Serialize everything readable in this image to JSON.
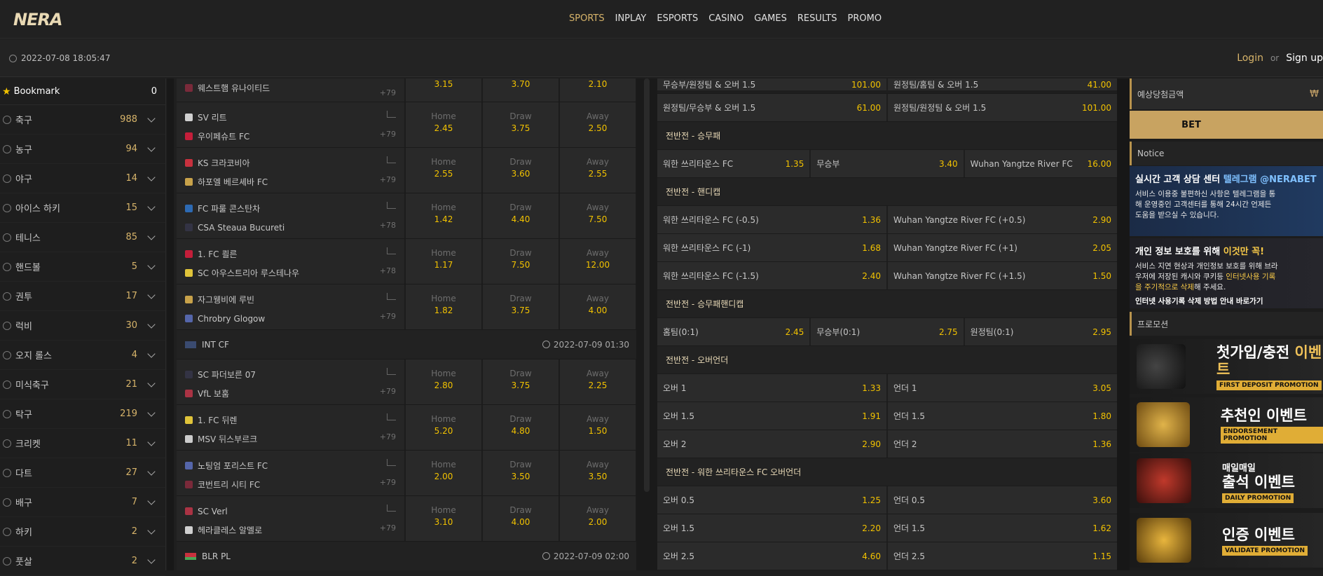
{
  "logo": "NERA",
  "nav": [
    "SPORTS",
    "INPLAY",
    "ESPORTS",
    "CASINO",
    "GAMES",
    "RESULTS",
    "PROMO"
  ],
  "datetime": "2022-07-08 18:05:47",
  "auth": {
    "login": "Login",
    "or": "or",
    "signup": "Sign up"
  },
  "sidebar": {
    "bookmark": {
      "label": "Bookmark",
      "count": "0"
    },
    "items": [
      {
        "label": "축구",
        "count": "988"
      },
      {
        "label": "농구",
        "count": "94"
      },
      {
        "label": "야구",
        "count": "14"
      },
      {
        "label": "아이스 하키",
        "count": "15"
      },
      {
        "label": "테니스",
        "count": "85"
      },
      {
        "label": "핸드볼",
        "count": "5"
      },
      {
        "label": "권투",
        "count": "17"
      },
      {
        "label": "럭비",
        "count": "30"
      },
      {
        "label": "오지 롤스",
        "count": "4"
      },
      {
        "label": "미식축구",
        "count": "21"
      },
      {
        "label": "탁구",
        "count": "219"
      },
      {
        "label": "크리켓",
        "count": "11"
      },
      {
        "label": "다트",
        "count": "27"
      },
      {
        "label": "배구",
        "count": "7"
      },
      {
        "label": "하키",
        "count": "2"
      },
      {
        "label": "풋살",
        "count": "2"
      }
    ]
  },
  "odds_labels": {
    "home": "Home",
    "draw": "Draw",
    "away": "Away"
  },
  "matches_top": [
    {
      "t1": "웨스트햄 유나이티드",
      "t2": "",
      "more": "+79",
      "home": "3.15",
      "draw": "3.70",
      "away": "2.10",
      "partial": true
    },
    {
      "t1": "SV 리트",
      "t2": "우이페슈트 FC",
      "more": "+79",
      "home": "2.45",
      "draw": "3.75",
      "away": "2.50"
    },
    {
      "t1": "KS 크라코비아",
      "t2": "하포엘 베르셰바 FC",
      "more": "+79",
      "home": "2.55",
      "draw": "3.60",
      "away": "2.55"
    },
    {
      "t1": "FC 파룰 콘스탄차",
      "t2": "CSA Steaua Bucureti",
      "more": "+78",
      "home": "1.42",
      "draw": "4.40",
      "away": "7.50"
    },
    {
      "t1": "1. FC 쾰른",
      "t2": "SC 아우스트리아 루스테나우",
      "more": "+78",
      "home": "1.17",
      "draw": "7.50",
      "away": "12.00"
    },
    {
      "t1": "자그웽비에 루빈",
      "t2": "Chrobry Glogow",
      "more": "+79",
      "home": "1.82",
      "draw": "3.75",
      "away": "4.00"
    }
  ],
  "league1": {
    "name": "INT CF",
    "date": "2022-07-09 01:30"
  },
  "matches_int": [
    {
      "t1": "SC 파더보른 07",
      "t2": "VfL 보훔",
      "more": "+79",
      "home": "2.80",
      "draw": "3.75",
      "away": "2.25"
    },
    {
      "t1": "1. FC 뒤렌",
      "t2": "MSV 뒤스부르크",
      "more": "+79",
      "home": "5.20",
      "draw": "4.80",
      "away": "1.50"
    },
    {
      "t1": "노팅엄 포리스트 FC",
      "t2": "코번트리 시티 FC",
      "more": "+79",
      "home": "2.00",
      "draw": "3.50",
      "away": "3.50"
    },
    {
      "t1": "SC Verl",
      "t2": "헤라클레스 알멜로",
      "more": "+79",
      "home": "3.10",
      "draw": "4.00",
      "away": "2.00"
    }
  ],
  "league2": {
    "name": "BLR PL",
    "date": "2022-07-09 02:00"
  },
  "detail": {
    "rows_top": [
      [
        {
          "n": "무승부/원정팀 & 오버 1.5",
          "v": "101.00"
        },
        {
          "n": "원정팀/홈팀 & 오버 1.5",
          "v": "41.00"
        }
      ],
      [
        {
          "n": "원정팀/무승부 & 오버 1.5",
          "v": "61.00"
        },
        {
          "n": "원정팀/원정팀 & 오버 1.5",
          "v": "101.00"
        }
      ]
    ],
    "sections": [
      {
        "title": "전반전 - 승무패",
        "rows": [
          [
            {
              "n": "워한 쓰리타운스 FC",
              "v": "1.35"
            },
            {
              "n": "무승부",
              "v": "3.40"
            },
            {
              "n": "Wuhan Yangtze River FC",
              "v": "16.00"
            }
          ]
        ]
      },
      {
        "title": "전반전 - 핸디캡",
        "rows": [
          [
            {
              "n": "워한 쓰리타운스 FC (-0.5)",
              "v": "1.36"
            },
            {
              "n": "Wuhan Yangtze River FC (+0.5)",
              "v": "2.90"
            }
          ],
          [
            {
              "n": "워한 쓰리타운스 FC (-1)",
              "v": "1.68"
            },
            {
              "n": "Wuhan Yangtze River FC (+1)",
              "v": "2.05"
            }
          ],
          [
            {
              "n": "워한 쓰리타운스 FC (-1.5)",
              "v": "2.40"
            },
            {
              "n": "Wuhan Yangtze River FC (+1.5)",
              "v": "1.50"
            }
          ]
        ]
      },
      {
        "title": "전반전 - 승무패핸디캡",
        "rows": [
          [
            {
              "n": "홈팀(0:1)",
              "v": "2.45"
            },
            {
              "n": "무승부(0:1)",
              "v": "2.75"
            },
            {
              "n": "원정팀(0:1)",
              "v": "2.95"
            }
          ]
        ]
      },
      {
        "title": "전반전 - 오버언더",
        "rows": [
          [
            {
              "n": "오버 1",
              "v": "1.33"
            },
            {
              "n": "언더 1",
              "v": "3.05"
            }
          ],
          [
            {
              "n": "오버 1.5",
              "v": "1.91"
            },
            {
              "n": "언더 1.5",
              "v": "1.80"
            }
          ],
          [
            {
              "n": "오버 2",
              "v": "2.90"
            },
            {
              "n": "언더 2",
              "v": "1.36"
            }
          ]
        ]
      },
      {
        "title": "전반전 - 워한 쓰리타운스 FC 오버언더",
        "rows": [
          [
            {
              "n": "오버 0.5",
              "v": "1.25"
            },
            {
              "n": "언더 0.5",
              "v": "3.60"
            }
          ],
          [
            {
              "n": "오버 1.5",
              "v": "2.20"
            },
            {
              "n": "언더 1.5",
              "v": "1.62"
            }
          ],
          [
            {
              "n": "오버 2.5",
              "v": "4.60"
            },
            {
              "n": "언더 2.5",
              "v": "1.15"
            }
          ]
        ]
      }
    ]
  },
  "right": {
    "bet_amount_label": "예상당첨금액",
    "won_symbol": "₩",
    "bet_button": "BET",
    "notice_label": "Notice",
    "notice1": {
      "title_a": "실시간 고객 상담 센터 ",
      "title_b": "텔레그램 @NERABET",
      "body": "서비스 이용중 불편하신 사항은 텔레그램을 통해 운영중인 고객센터를 통해 24시간 언제든 도움을 받으실 수 있습니다."
    },
    "notice2": {
      "title_a": "개인 정보 보호를 위해 ",
      "title_b": "이것만 꼭!",
      "body_a": "서비스 지연 현상과 개인정보 보호를 위해 브라우저에 저장된 캐시와 쿠키등 ",
      "body_hl": "인터넷사용 기록을 주기적으로 삭제",
      "body_b": "해 주세요.",
      "footer": "인터넷 사용기록 삭제 방법 안내 바로가기"
    },
    "promo_label": "프로모션",
    "promos": [
      {
        "pre": "",
        "ko_a": "첫가입/충전 ",
        "ko_b": "이벤트",
        "en": "FIRST DEPOSIT PROMOTION"
      },
      {
        "pre": "",
        "ko_a": "추천인 이벤트",
        "ko_b": "",
        "en": "ENDORSEMENT PROMOTION"
      },
      {
        "pre": "매일매일",
        "ko_a": "출석 이벤트",
        "ko_b": "",
        "en": "DAILY PROMOTION"
      },
      {
        "pre": "",
        "ko_a": "인증 이벤트",
        "ko_b": "",
        "en": "VALIDATE PROMOTION"
      }
    ]
  },
  "colors": {
    "accent": "#d7b46a",
    "odds": "#f2c200",
    "bet": "#c8a361"
  }
}
